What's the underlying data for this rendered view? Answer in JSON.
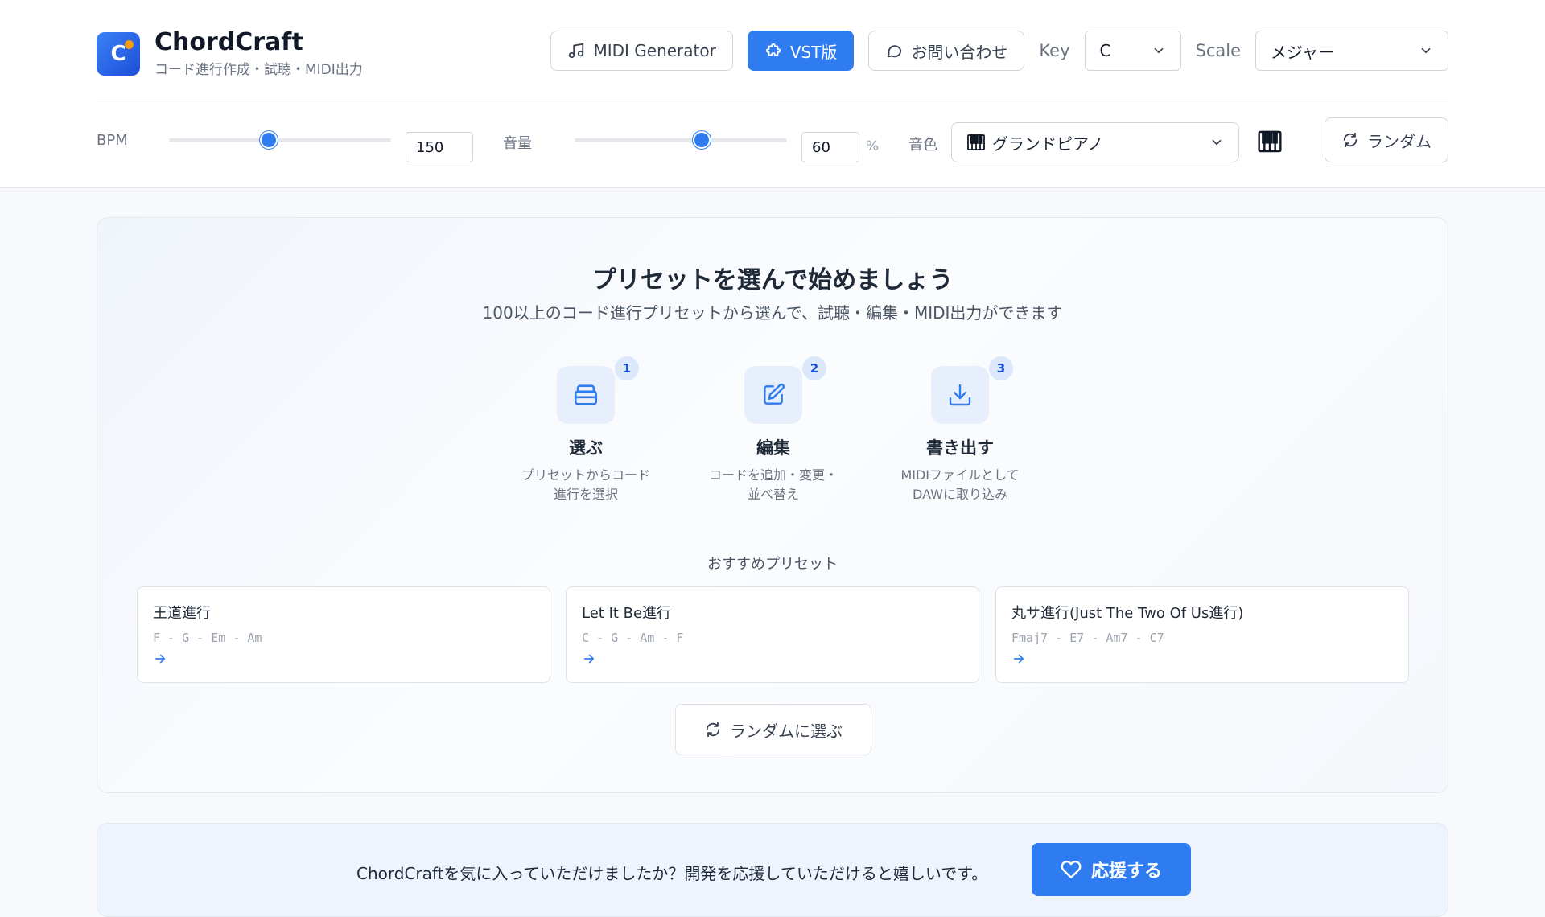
{
  "app": {
    "name": "ChordCraft",
    "tagline": "コード進行作成・試聴・MIDI出力",
    "logo_letter": "C"
  },
  "topbar": {
    "midi_label": "MIDI Generator",
    "vst_label": "VST版",
    "contact_label": "お問い合わせ",
    "key_label": "Key",
    "key_value": "C",
    "scale_label": "Scale",
    "scale_value": "メジャー"
  },
  "controls": {
    "bpm_label": "BPM",
    "bpm_value": "150",
    "bpm_level": 0.45,
    "volume_label": "音量",
    "volume_value": "60",
    "volume_unit": "%",
    "volume_level": 0.6,
    "tone_label": "音色",
    "instrument": "グランドピアノ",
    "random_label": "ランダム"
  },
  "hero": {
    "title": "プリセットを選んで始めましょう",
    "subtitle": "100以上のコード進行プリセットから選んで、試聴・編集・MIDI出力ができます"
  },
  "steps": [
    {
      "badge": "1",
      "title": "選ぶ",
      "desc_line1": "プリセットからコード",
      "desc_line2": "進行を選択"
    },
    {
      "badge": "2",
      "title": "編集",
      "desc_line1": "コードを追加・変更・",
      "desc_line2": "並べ替え"
    },
    {
      "badge": "3",
      "title": "書き出す",
      "desc_line1": "MIDIファイルとして",
      "desc_line2": "DAWに取り込み"
    }
  ],
  "recommended": {
    "title": "おすすめプリセット",
    "presets": [
      {
        "name": "王道進行",
        "chords": "F - G - Em - Am"
      },
      {
        "name": "Let It Be進行",
        "chords": "C - G - Am - F"
      },
      {
        "name": "丸サ進行(Just The Two Of Us進行)",
        "chords": "Fmaj7 - E7 - Am7 - C7"
      }
    ],
    "random_pick_label": "ランダムに選ぶ"
  },
  "support": {
    "message": "ChordCraftを気に入っていただけましたか？開発を応援していただけると嬉しいです。",
    "button_label": "応援する"
  },
  "colors": {
    "accent": "#2f7cf0",
    "logo_dot": "#f59e0b"
  }
}
